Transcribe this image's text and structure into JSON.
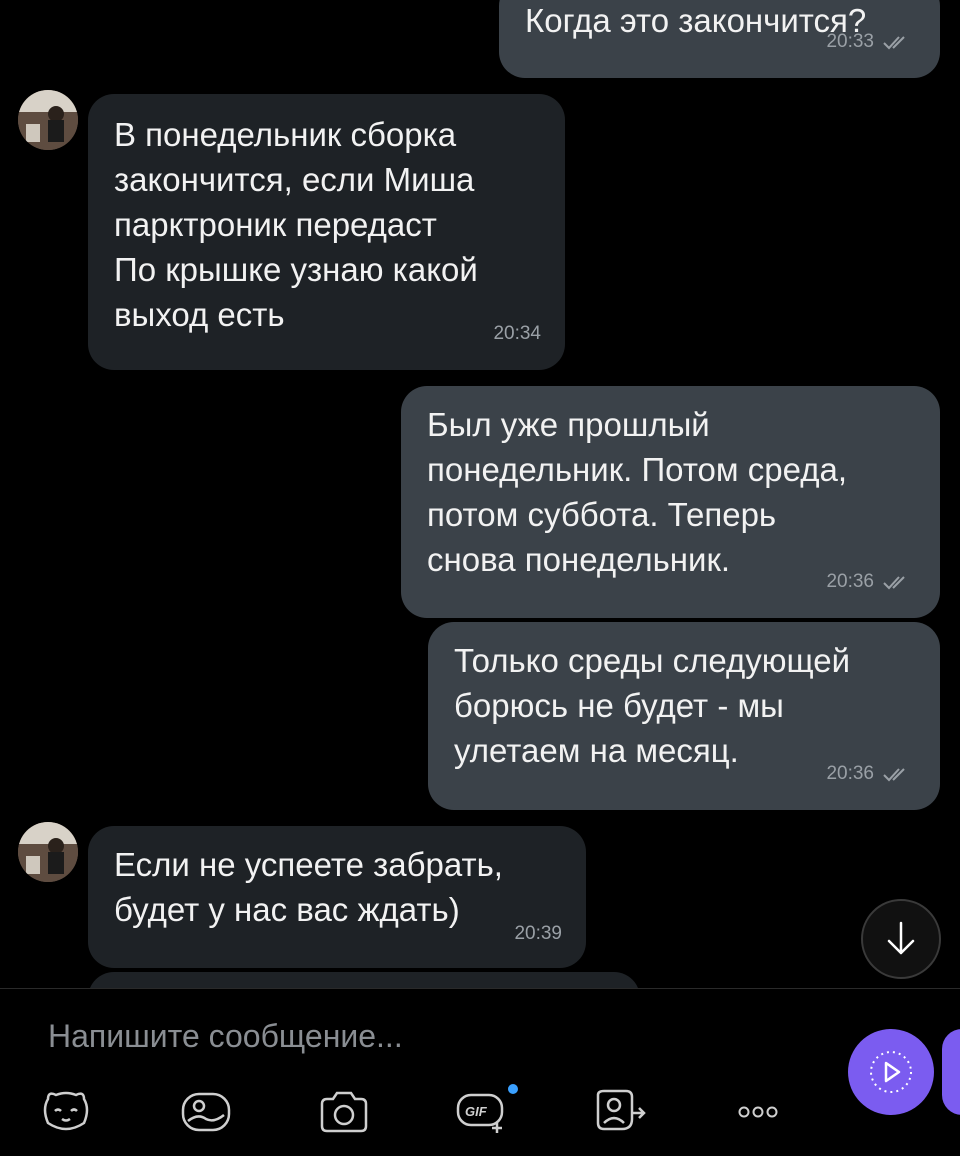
{
  "messages": [
    {
      "direction": "out",
      "text": "Когда это закончится?",
      "time": "20:33"
    },
    {
      "direction": "in",
      "text": "В понедельник сборка\nзакончится, если Миша\nпарктроник передаст\nПо крышке узнаю какой\nвыход есть",
      "time": "20:34"
    },
    {
      "direction": "out",
      "text": "Был уже прошлый\nпонедельник. Потом среда,\nпотом суббота. Теперь\nснова понедельник.",
      "time": "20:36"
    },
    {
      "direction": "out",
      "text": "Только среды следующей\nборюсь не будет - мы\nулетаем на месяц.",
      "time": "20:36"
    },
    {
      "direction": "in",
      "text": "Если не успеете забрать,\nбудет у нас вас ждать)",
      "time": "20:39"
    }
  ],
  "composer": {
    "placeholder": "Напишите сообщение...",
    "tools": [
      "sticker-icon",
      "image-icon",
      "camera-icon",
      "gif-icon",
      "mention-icon",
      "more-icon"
    ]
  },
  "colors": {
    "outgoing": "#3b4249",
    "incoming": "#1e2226",
    "accent": "#7b5cf0"
  }
}
